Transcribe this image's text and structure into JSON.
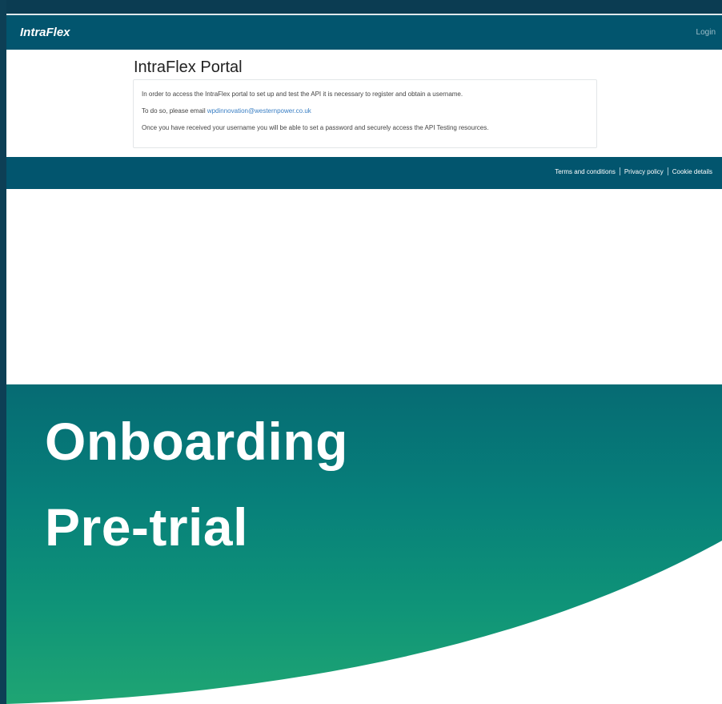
{
  "navbar": {
    "brand": "IntraFlex",
    "login_label": "Login"
  },
  "main": {
    "title": "IntraFlex Portal",
    "paragraph_1": "In order to access the IntraFlex portal to set up and test the API it is necessary to register and obtain a username.",
    "paragraph_2_prefix": "To do so, please email ",
    "email": "wpdinnovation@westernpower.co.uk",
    "paragraph_3": "Once you have received your username you will be able to set a password and securely access the API Testing resources."
  },
  "footer": {
    "links": [
      "Terms and conditions",
      "Privacy policy",
      "Cookie details"
    ]
  },
  "banner": {
    "line_1": "Onboarding",
    "line_2": "Pre-trial"
  },
  "colors": {
    "navbar": "#02556e",
    "link": "#3a7fc4",
    "banner_top": "#066b73",
    "banner_bottom": "#1fa573"
  }
}
